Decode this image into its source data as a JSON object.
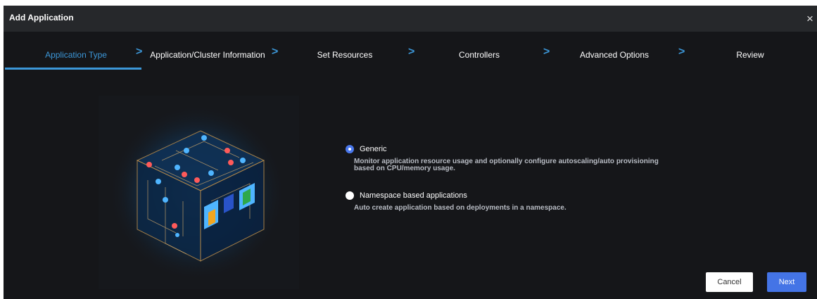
{
  "dialog": {
    "title": "Add Application",
    "close_glyph": "×"
  },
  "steps": [
    {
      "label": "Application Type",
      "active": true
    },
    {
      "label": "Application/Cluster Information"
    },
    {
      "label": "Set Resources"
    },
    {
      "label": "Controllers"
    },
    {
      "label": "Advanced Options"
    },
    {
      "label": "Review"
    }
  ],
  "step_separator": ">",
  "options": [
    {
      "label": "Generic",
      "checked": true,
      "description_line1": "Monitor application resource usage and optionally configure autoscaling/auto provisioning",
      "description_line2": "based on CPU/memory usage."
    },
    {
      "label": "Namespace based applications",
      "checked": false,
      "description_line1": "Auto create application based on deployments in a namespace."
    }
  ],
  "buttons": {
    "cancel": "Cancel",
    "next": "Next"
  },
  "colors": {
    "accent": "#3c97d8",
    "primary_button": "#4474e6",
    "background": "#151619",
    "titlebar": "#26282b"
  }
}
